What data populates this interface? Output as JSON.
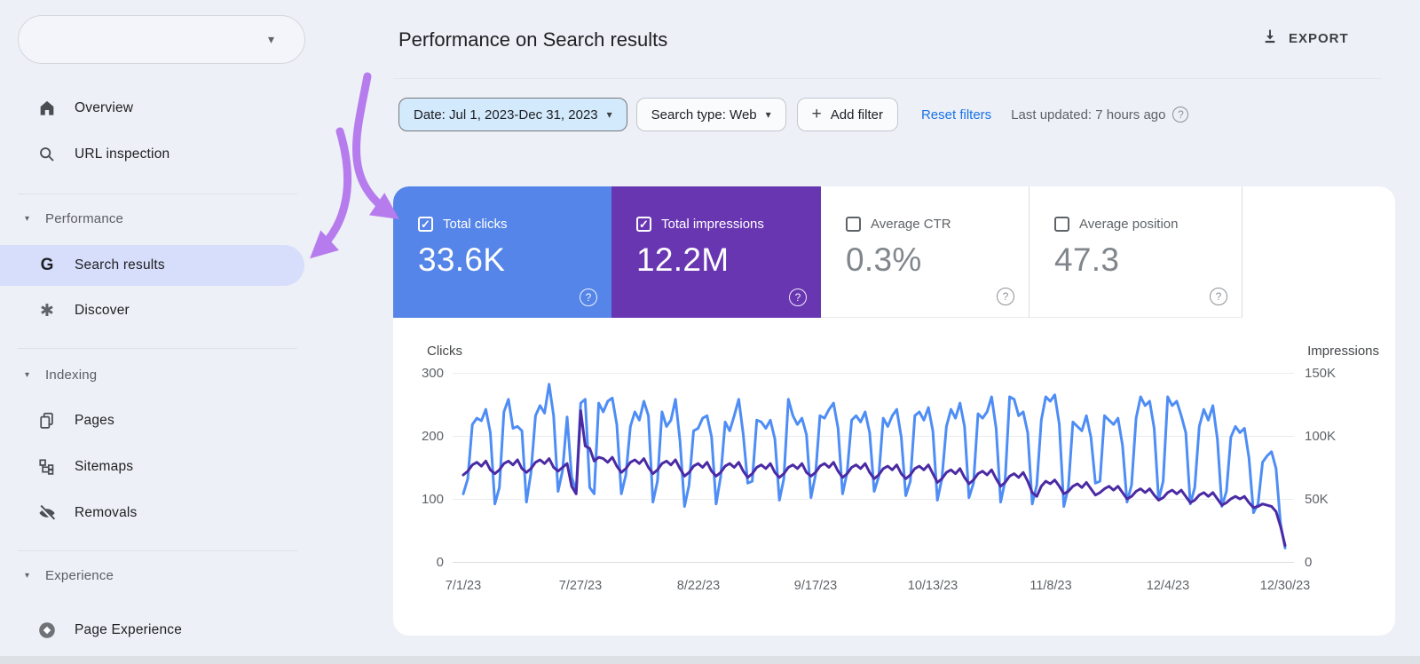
{
  "icons": {
    "chevron_down": "▾",
    "check": "✓",
    "question": "?",
    "plus": "+",
    "discover_asterisk": "✱",
    "google_g": "G"
  },
  "colors": {
    "page_bg": "#edf0f6",
    "selected_nav_bg": "#d7defb",
    "link_blue": "#1a73e8",
    "arrow_purple": "#b67ced",
    "clicks_card_bg": "#5585e8",
    "impressions_card_bg": "#6936b2"
  },
  "sidebar": {
    "property_selector": {
      "value": ""
    },
    "top_items": [
      {
        "label": "Overview"
      },
      {
        "label": "URL inspection"
      }
    ],
    "sections": [
      {
        "label": "Performance",
        "items": [
          {
            "label": "Search results",
            "selected": true
          },
          {
            "label": "Discover",
            "selected": false
          }
        ]
      },
      {
        "label": "Indexing",
        "items": [
          {
            "label": "Pages"
          },
          {
            "label": "Sitemaps"
          },
          {
            "label": "Removals"
          }
        ]
      },
      {
        "label": "Experience",
        "items": [
          {
            "label": "Page Experience"
          }
        ]
      }
    ]
  },
  "header": {
    "title": "Performance on Search results",
    "export_label": "EXPORT"
  },
  "filter_bar": {
    "date_filter": "Date: Jul 1, 2023-Dec 31, 2023",
    "search_type_filter": "Search type: Web",
    "add_filter_label": "Add filter",
    "reset_filters_label": "Reset filters",
    "last_updated": "Last updated: 7 hours ago"
  },
  "metric_cards": [
    {
      "label": "Total clicks",
      "value": "33.6K",
      "checked": true
    },
    {
      "label": "Total impressions",
      "value": "12.2M",
      "checked": true
    },
    {
      "label": "Average CTR",
      "value": "0.3%",
      "checked": false
    },
    {
      "label": "Average position",
      "value": "47.3",
      "checked": false
    }
  ],
  "chart_data": {
    "type": "line",
    "x_tick_labels": [
      "7/1/23",
      "7/27/23",
      "8/22/23",
      "9/17/23",
      "10/13/23",
      "11/8/23",
      "12/4/23",
      "12/30/23"
    ],
    "left_axis": {
      "label": "Clicks",
      "min": 0,
      "max": 300,
      "ticks": [
        "300",
        "200",
        "100",
        "0"
      ]
    },
    "right_axis": {
      "label": "Impressions",
      "min": 0,
      "max": 150000,
      "max_k": 150,
      "ticks": [
        "150K",
        "100K",
        "50K",
        "0"
      ]
    },
    "grid": true,
    "series": [
      {
        "name": "Clicks",
        "axis": "left",
        "color": "#4e8df5",
        "unit": "clicks per day",
        "values": [
          108,
          132,
          218,
          228,
          224,
          242,
          205,
          92,
          118,
          238,
          258,
          212,
          215,
          208,
          95,
          142,
          232,
          248,
          236,
          282,
          232,
          112,
          145,
          230,
          135,
          112,
          252,
          258,
          118,
          108,
          252,
          238,
          255,
          260,
          218,
          108,
          138,
          215,
          238,
          225,
          255,
          232,
          95,
          128,
          238,
          215,
          225,
          258,
          192,
          88,
          122,
          208,
          212,
          228,
          232,
          198,
          92,
          135,
          222,
          208,
          232,
          258,
          202,
          125,
          128,
          225,
          222,
          212,
          225,
          195,
          98,
          132,
          258,
          232,
          218,
          228,
          202,
          102,
          138,
          232,
          228,
          242,
          252,
          212,
          108,
          142,
          225,
          232,
          222,
          238,
          205,
          112,
          135,
          228,
          215,
          232,
          242,
          198,
          105,
          128,
          232,
          238,
          225,
          245,
          208,
          98,
          132,
          215,
          242,
          228,
          252,
          215,
          102,
          125,
          235,
          228,
          238,
          262,
          212,
          95,
          128,
          262,
          258,
          232,
          238,
          205,
          92,
          122,
          225,
          262,
          255,
          265,
          218,
          88,
          118,
          222,
          215,
          208,
          232,
          198,
          125,
          128,
          232,
          225,
          218,
          228,
          185,
          95,
          122,
          228,
          262,
          248,
          255,
          212,
          98,
          128,
          262,
          248,
          255,
          232,
          205,
          92,
          118,
          215,
          242,
          225,
          248,
          195,
          88,
          112,
          198,
          215,
          205,
          212,
          165,
          78,
          92,
          158,
          168,
          175,
          148,
          60,
          22
        ]
      },
      {
        "name": "Impressions",
        "axis": "right",
        "color": "#4b2aa3",
        "unit": "thousands of impressions per day",
        "values": [
          69,
          72,
          77,
          79,
          76,
          80,
          73,
          70,
          73,
          78,
          80,
          77,
          81,
          74,
          71,
          74,
          79,
          81,
          78,
          82,
          75,
          72,
          75,
          78,
          60,
          54,
          120,
          92,
          90,
          80,
          83,
          82,
          79,
          83,
          76,
          71,
          74,
          79,
          81,
          78,
          82,
          75,
          70,
          73,
          78,
          80,
          77,
          81,
          74,
          68,
          71,
          76,
          78,
          75,
          79,
          72,
          68,
          71,
          76,
          78,
          75,
          79,
          72,
          67,
          70,
          75,
          77,
          74,
          78,
          71,
          67,
          70,
          75,
          77,
          74,
          78,
          71,
          68,
          71,
          76,
          78,
          75,
          79,
          72,
          67,
          70,
          75,
          77,
          74,
          78,
          71,
          66,
          69,
          74,
          76,
          73,
          77,
          70,
          66,
          69,
          74,
          76,
          73,
          77,
          70,
          63,
          66,
          71,
          73,
          70,
          74,
          67,
          62,
          65,
          70,
          72,
          69,
          73,
          66,
          60,
          63,
          68,
          70,
          67,
          71,
          64,
          55,
          52,
          60,
          64,
          62,
          65,
          60,
          54,
          56,
          60,
          62,
          59,
          63,
          58,
          53,
          55,
          58,
          60,
          57,
          60,
          55,
          50,
          52,
          56,
          58,
          55,
          58,
          53,
          49,
          51,
          55,
          57,
          54,
          57,
          52,
          47,
          49,
          53,
          55,
          52,
          55,
          50,
          45,
          47,
          50,
          52,
          50,
          52,
          47,
          43,
          44,
          46,
          45,
          44,
          40,
          28,
          13
        ]
      }
    ]
  }
}
